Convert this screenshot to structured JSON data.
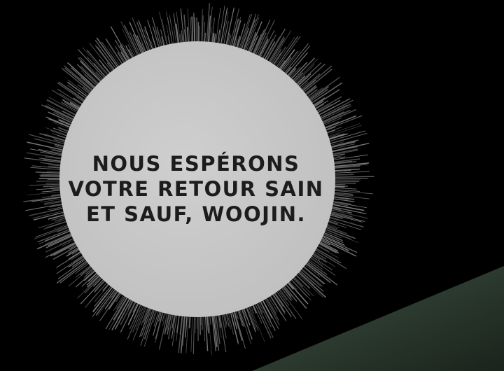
{
  "speech_bubble": {
    "lines": [
      "NOUS ESPÉRONS",
      "VOTRE RETOUR SAIN",
      "ET SAUF, WOOJIN."
    ]
  },
  "colors": {
    "background": "#000000",
    "bubble_fill": "#c8c8c8",
    "spike_stroke": "#6a6a6a",
    "scene_green_dark": "#1f2a22",
    "scene_green_light": "#5e6e60",
    "text": "#1c1c1c"
  }
}
